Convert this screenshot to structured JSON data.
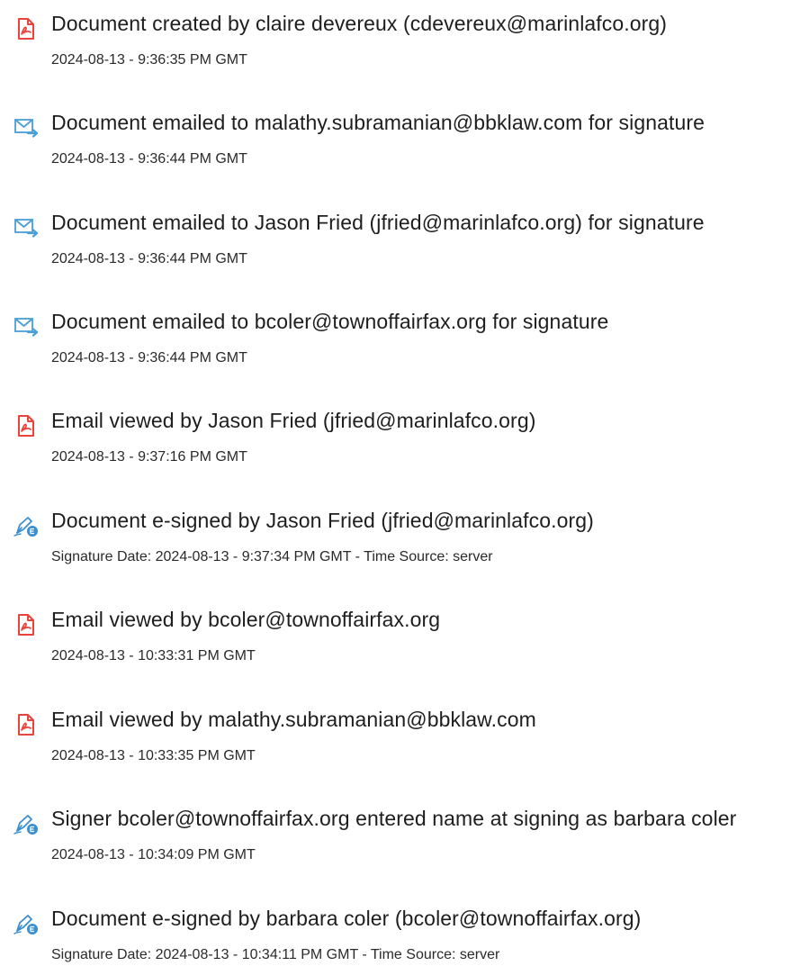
{
  "colors": {
    "pdf_icon": "#e8433c",
    "mail_icon": "#4a9fd6",
    "sign_icon": "#3a8fd0"
  },
  "entries": [
    {
      "icon": "document-pdf-icon",
      "text": "Document created by claire devereux (cdevereux@marinlafco.org)",
      "sub": "2024-08-13 - 9:36:35 PM GMT"
    },
    {
      "icon": "email-sent-icon",
      "text": "Document emailed to malathy.subramanian@bbklaw.com for signature",
      "sub": "2024-08-13 - 9:36:44 PM GMT"
    },
    {
      "icon": "email-sent-icon",
      "text": "Document emailed to Jason Fried (jfried@marinlafco.org) for signature",
      "sub": "2024-08-13 - 9:36:44 PM GMT"
    },
    {
      "icon": "email-sent-icon",
      "text": "Document emailed to bcoler@townoffairfax.org for signature",
      "sub": "2024-08-13 - 9:36:44 PM GMT"
    },
    {
      "icon": "document-pdf-icon",
      "text": "Email viewed by Jason Fried (jfried@marinlafco.org)",
      "sub": "2024-08-13 - 9:37:16 PM GMT"
    },
    {
      "icon": "e-sign-pen-icon",
      "text": "Document e-signed by Jason Fried (jfried@marinlafco.org)",
      "sub": "Signature Date: 2024-08-13 - 9:37:34 PM GMT - Time Source: server"
    },
    {
      "icon": "document-pdf-icon",
      "text": "Email viewed by bcoler@townoffairfax.org",
      "sub": "2024-08-13 - 10:33:31 PM GMT"
    },
    {
      "icon": "document-pdf-icon",
      "text": "Email viewed by malathy.subramanian@bbklaw.com",
      "sub": "2024-08-13 - 10:33:35 PM GMT"
    },
    {
      "icon": "e-sign-pen-icon",
      "text": "Signer bcoler@townoffairfax.org entered name at signing as barbara coler",
      "sub": "2024-08-13 - 10:34:09 PM GMT"
    },
    {
      "icon": "e-sign-pen-icon",
      "text": "Document e-signed by barbara coler (bcoler@townoffairfax.org)",
      "sub": "Signature Date: 2024-08-13 - 10:34:11 PM GMT - Time Source: server"
    }
  ]
}
